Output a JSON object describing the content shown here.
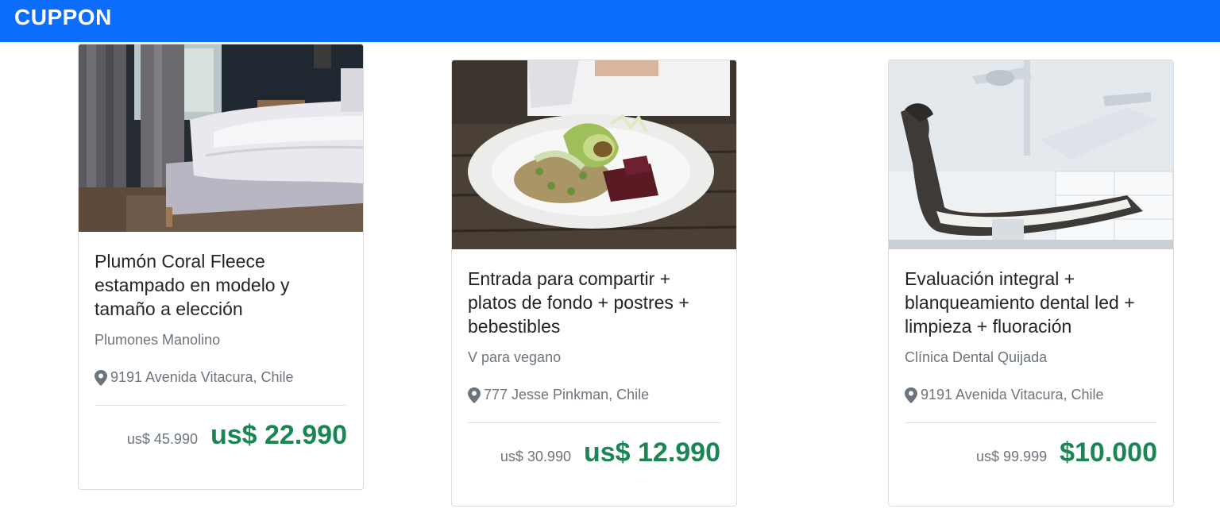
{
  "header": {
    "brand": "CUPPON"
  },
  "cards": [
    {
      "title": "Plumón Coral Fleece estampado en modelo y tamaño a elección",
      "seller": "Plumones Manolino",
      "location": "9191 Avenida Vitacura, Chile",
      "price_old": "us$ 45.990",
      "price_new": "us$ 22.990",
      "image": "bedroom-photo"
    },
    {
      "title": "Entrada para compartir + platos de fondo + postres + bebestibles",
      "seller": "V para vegano",
      "location": "777 Jesse Pinkman, Chile",
      "price_old": "us$ 30.990",
      "price_new": "us$ 12.990",
      "image": "vegan-dish-photo"
    },
    {
      "title": "Evaluación integral + blanqueamiento dental led + limpieza + fluoración",
      "seller": "Clínica Dental Quijada",
      "location": "9191 Avenida Vitacura, Chile",
      "price_old": "us$ 99.999",
      "price_new": "$10.000",
      "image": "dental-chair-photo"
    }
  ],
  "colors": {
    "navbar": "#0d6efd",
    "price_new": "#198754",
    "muted": "#6c757d"
  },
  "icons": {
    "location": "map-pin-icon"
  }
}
